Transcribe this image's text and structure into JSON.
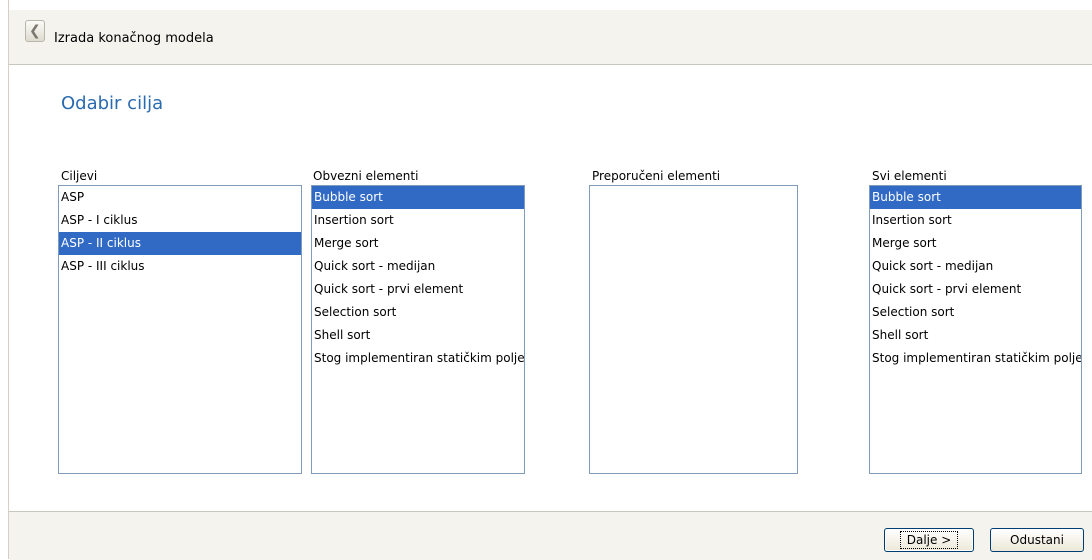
{
  "header": {
    "back_icon": "chevron-left-icon",
    "title": "Izrada konačnog modela"
  },
  "page_title": "Odabir cilja",
  "lists": [
    {
      "label": "Ciljevi",
      "items": [
        "ASP",
        "ASP - I ciklus",
        "ASP - II ciklus",
        "ASP - III ciklus"
      ],
      "selected_index": 2
    },
    {
      "label": "Obvezni elementi",
      "items": [
        "Bubble sort",
        "Insertion sort",
        "Merge sort",
        "Quick sort - medijan",
        "Quick sort - prvi element",
        "Selection sort",
        "Shell sort",
        "Stog implementiran statičkim poljem"
      ],
      "selected_index": 0
    },
    {
      "label": "Preporučeni elementi",
      "items": [],
      "selected_index": -1
    },
    {
      "label": "Svi elementi",
      "items": [
        "Bubble sort",
        "Insertion sort",
        "Merge sort",
        "Quick sort - medijan",
        "Quick sort - prvi element",
        "Selection sort",
        "Shell sort",
        "Stog implementiran statičkim poljem"
      ],
      "selected_index": 0
    }
  ],
  "footer": {
    "next_label": "Dalje >",
    "cancel_label": "Odustani"
  },
  "colors": {
    "accent": "#2a6bb0",
    "selection": "#316ac5"
  }
}
